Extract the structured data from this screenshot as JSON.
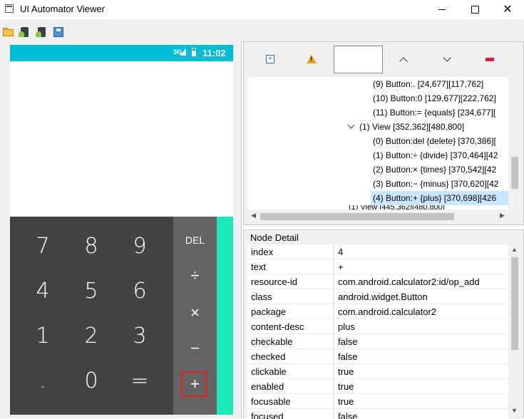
{
  "window": {
    "title": "UI Automator Viewer",
    "controls": [
      "minimize",
      "maximize",
      "close"
    ]
  },
  "toolbar": {
    "buttons": [
      "open-icon",
      "device-screenshot-icon",
      "device-screenshot-compressed-icon",
      "save-icon"
    ]
  },
  "device": {
    "status_time": "11:02",
    "network": "3G",
    "keypad": {
      "digits": [
        "7",
        "8",
        "9",
        "4",
        "5",
        "6",
        "1",
        "2",
        "3",
        ".",
        "0",
        "="
      ],
      "operators": [
        "DEL",
        "÷",
        "×",
        "−",
        "+"
      ],
      "highlighted_operator": "+"
    },
    "colors": {
      "status_bar": "#00bcd4",
      "keypad": "#434343",
      "operators": "#636363",
      "advanced": "#1de9b6",
      "highlight": "#e81c1c"
    }
  },
  "tree": {
    "nodes": [
      {
        "label": "(9) Button:. [24,677][117,762]",
        "selected": false
      },
      {
        "label": "(10) Button:0 [129,677][222,762]",
        "selected": false
      },
      {
        "label": "(11) Button:= {equals} [234,677][",
        "selected": false
      },
      {
        "label": "(1) View [352,362][480,800]",
        "selected": false,
        "expanded": true
      },
      {
        "label": "(0) Button:del {delete} [370,386][",
        "selected": false
      },
      {
        "label": "(1) Button:÷ {divide} [370,464][42",
        "selected": false
      },
      {
        "label": "(2) Button:× {times} [370,542][42",
        "selected": false
      },
      {
        "label": "(3) Button:− {minus} [370,620][42",
        "selected": false
      },
      {
        "label": "(4) Button:+ {plus} [370,698][426",
        "selected": true
      },
      {
        "label": "(1) View [445,362][480,800]",
        "selected": false
      }
    ]
  },
  "detail": {
    "title": "Node Detail",
    "rows": [
      {
        "key": "index",
        "value": "4"
      },
      {
        "key": "text",
        "value": "+"
      },
      {
        "key": "resource-id",
        "value": "com.android.calculator2:id/op_add"
      },
      {
        "key": "class",
        "value": "android.widget.Button"
      },
      {
        "key": "package",
        "value": "com.android.calculator2"
      },
      {
        "key": "content-desc",
        "value": "plus"
      },
      {
        "key": "checkable",
        "value": "false"
      },
      {
        "key": "checked",
        "value": "false"
      },
      {
        "key": "clickable",
        "value": "true"
      },
      {
        "key": "enabled",
        "value": "true"
      },
      {
        "key": "focusable",
        "value": "true"
      },
      {
        "key": "focused",
        "value": "false"
      }
    ]
  }
}
